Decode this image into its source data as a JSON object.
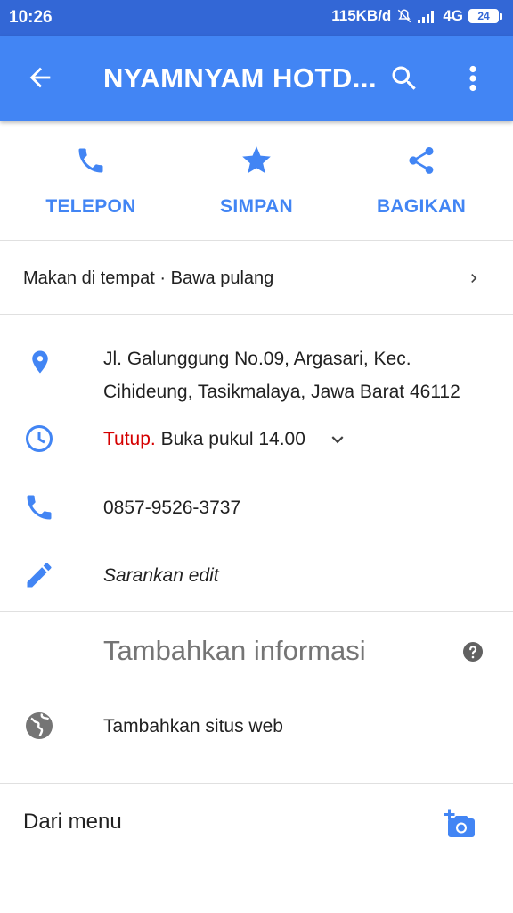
{
  "status_bar": {
    "time": "10:26",
    "net_speed": "115KB/d",
    "network": "4G",
    "battery": "24"
  },
  "app_bar": {
    "title": "NYAMNYAM HOTD...",
    "back_icon": "arrow-back-icon",
    "search_icon": "search-icon",
    "more_icon": "more-vert-icon"
  },
  "actions": [
    {
      "label": "TELEPON",
      "icon": "phone-icon"
    },
    {
      "label": "SIMPAN",
      "icon": "star-icon"
    },
    {
      "label": "BAGIKAN",
      "icon": "share-icon"
    }
  ],
  "services": {
    "text": "Makan di tempat · Bawa pulang"
  },
  "details": {
    "address_line1": "Jl. Galunggung No.09, Argasari, Kec.",
    "address_line2": "Cihideung, Tasikmalaya, Jawa Barat 46112",
    "hours_status": "Tutup.",
    "hours_text": " Buka pukul 14.00",
    "phone": "0857-9526-3737",
    "suggest_edit": "Sarankan edit"
  },
  "add_info": {
    "heading": "Tambahkan informasi",
    "website": "Tambahkan situs web"
  },
  "menu": {
    "title": "Dari menu"
  },
  "colors": {
    "status_bar": "#3367d6",
    "app_bar": "#4285f4",
    "accent": "#4285f4",
    "closed": "#d50000"
  }
}
